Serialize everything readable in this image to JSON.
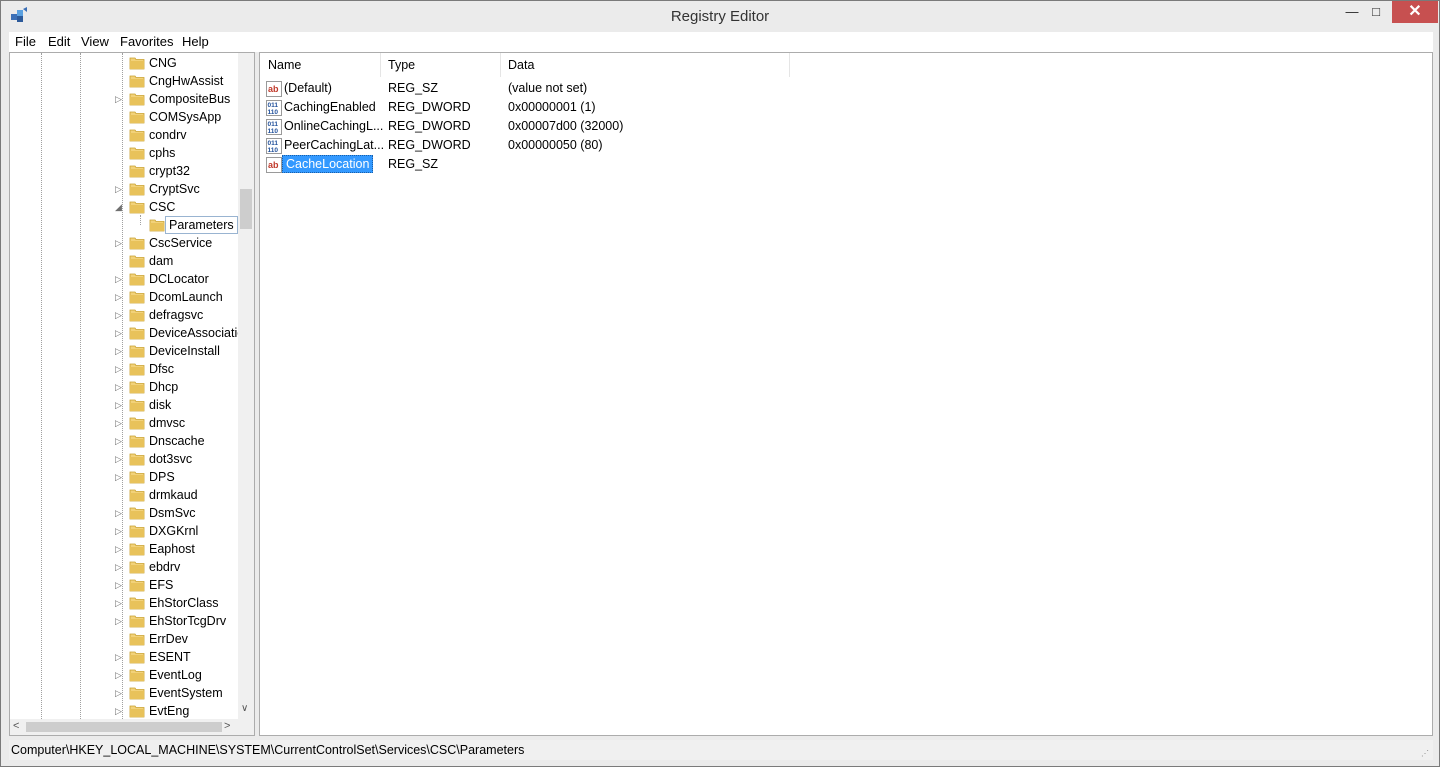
{
  "window": {
    "title": "Registry Editor",
    "icon": "registry-editor-icon",
    "controls": {
      "minimize": "—",
      "maximize": "□",
      "close": "✕"
    }
  },
  "menu": [
    "File",
    "Edit",
    "View",
    "Favorites",
    "Help"
  ],
  "tree": {
    "items": [
      {
        "label": "CNG",
        "expander": ""
      },
      {
        "label": "CngHwAssist",
        "expander": ""
      },
      {
        "label": "CompositeBus",
        "expander": "▷"
      },
      {
        "label": "COMSysApp",
        "expander": ""
      },
      {
        "label": "condrv",
        "expander": ""
      },
      {
        "label": "cphs",
        "expander": ""
      },
      {
        "label": "crypt32",
        "expander": ""
      },
      {
        "label": "CryptSvc",
        "expander": "▷"
      },
      {
        "label": "CSC",
        "expander": "◢"
      },
      {
        "label": "Parameters",
        "expander": "",
        "child": true,
        "selected": true
      },
      {
        "label": "CscService",
        "expander": "▷"
      },
      {
        "label": "dam",
        "expander": ""
      },
      {
        "label": "DCLocator",
        "expander": "▷"
      },
      {
        "label": "DcomLaunch",
        "expander": "▷"
      },
      {
        "label": "defragsvc",
        "expander": "▷"
      },
      {
        "label": "DeviceAssociatio",
        "expander": "▷"
      },
      {
        "label": "DeviceInstall",
        "expander": "▷"
      },
      {
        "label": "Dfsc",
        "expander": "▷"
      },
      {
        "label": "Dhcp",
        "expander": "▷"
      },
      {
        "label": "disk",
        "expander": "▷"
      },
      {
        "label": "dmvsc",
        "expander": "▷"
      },
      {
        "label": "Dnscache",
        "expander": "▷"
      },
      {
        "label": "dot3svc",
        "expander": "▷"
      },
      {
        "label": "DPS",
        "expander": "▷"
      },
      {
        "label": "drmkaud",
        "expander": ""
      },
      {
        "label": "DsmSvc",
        "expander": "▷"
      },
      {
        "label": "DXGKrnl",
        "expander": "▷"
      },
      {
        "label": "Eaphost",
        "expander": "▷"
      },
      {
        "label": "ebdrv",
        "expander": "▷"
      },
      {
        "label": "EFS",
        "expander": "▷"
      },
      {
        "label": "EhStorClass",
        "expander": "▷"
      },
      {
        "label": "EhStorTcgDrv",
        "expander": "▷"
      },
      {
        "label": "ErrDev",
        "expander": ""
      },
      {
        "label": "ESENT",
        "expander": "▷"
      },
      {
        "label": "EventLog",
        "expander": "▷"
      },
      {
        "label": "EventSystem",
        "expander": "▷"
      },
      {
        "label": "EvtEng",
        "expander": "▷"
      }
    ],
    "scroll_left": "<",
    "scroll_right": ">",
    "scroll_down": "∨"
  },
  "list": {
    "columns": {
      "name": "Name",
      "type": "Type",
      "data": "Data"
    },
    "rows": [
      {
        "icon": "string-value-icon",
        "name": "(Default)",
        "type": "REG_SZ",
        "data": "(value not set)"
      },
      {
        "icon": "dword-value-icon",
        "name": "CachingEnabled",
        "type": "REG_DWORD",
        "data": "0x00000001 (1)"
      },
      {
        "icon": "dword-value-icon",
        "name": "OnlineCachingL...",
        "type": "REG_DWORD",
        "data": "0x00007d00 (32000)"
      },
      {
        "icon": "dword-value-icon",
        "name": "PeerCachingLat...",
        "type": "REG_DWORD",
        "data": "0x00000050 (80)"
      },
      {
        "icon": "string-value-icon",
        "name": "CacheLocation",
        "type": "REG_SZ",
        "data": "",
        "selected": true
      }
    ]
  },
  "status": {
    "path": "Computer\\HKEY_LOCAL_MACHINE\\SYSTEM\\CurrentControlSet\\Services\\CSC\\Parameters",
    "grip": "⋰"
  },
  "colors": {
    "selection": "#3399ff",
    "folder": "#e8c25a",
    "close_button": "#c75050"
  }
}
